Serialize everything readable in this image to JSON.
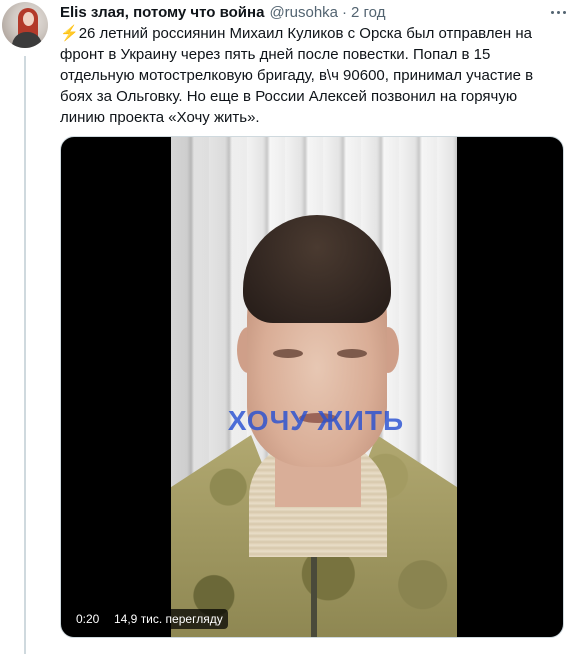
{
  "tweet": {
    "author_name": "Elis злая, потому что война",
    "handle": "@rusohka",
    "separator": "·",
    "time": "2 год",
    "text": "26 летний россиянин Михаил Куликов с Орска был отправлен на фронт в Украину через пять дней после повестки. Попал в 15 отдельную мотострелковую бригаду, в\\ч 90600, принимал участие в боях за Ольговку. Но еще в России Алексей позвонил на горячую линию проекта «Хочу жить».",
    "emoji_icon": "high-voltage-icon",
    "emoji_char": "⚡",
    "more_icon": "more-options-icon"
  },
  "video": {
    "watermark": "ХОЧУ ЖИТЬ",
    "duration": "0:20",
    "views": "14,9 тис. перегляду"
  },
  "colors": {
    "text": "#0f1419",
    "secondary": "#536471",
    "watermark": "#2850d2",
    "bolt": "#ffac33"
  }
}
